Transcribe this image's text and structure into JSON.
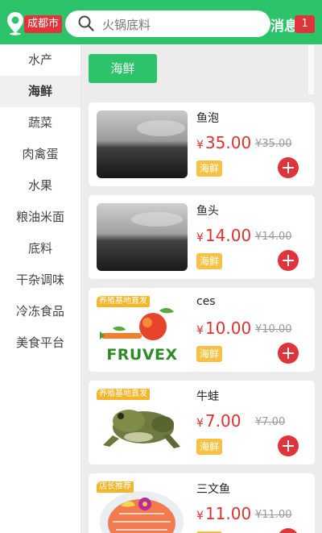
{
  "header": {
    "city": "成都市",
    "search_placeholder": "火锅底料",
    "messages_label": "消息",
    "messages_count": "1",
    "accent_color": "#2cc36b"
  },
  "sidebar": {
    "items": [
      {
        "label": "水产"
      },
      {
        "label": "海鲜",
        "active": true
      },
      {
        "label": "蔬菜"
      },
      {
        "label": "肉禽蛋"
      },
      {
        "label": "水果"
      },
      {
        "label": "粮油米面"
      },
      {
        "label": "底料"
      },
      {
        "label": "干杂调味"
      },
      {
        "label": "冷冻食品"
      },
      {
        "label": "美食平台"
      }
    ]
  },
  "subcategory": {
    "selected": "海鲜"
  },
  "products": [
    {
      "name": "鱼泡",
      "currency": "¥",
      "price": "35.00",
      "original_price": "¥35.00",
      "tag": "海鲜",
      "image_icon": "fish-photo"
    },
    {
      "name": "鱼头",
      "currency": "¥",
      "price": "14.00",
      "original_price": "¥14.00",
      "tag": "海鲜",
      "image_icon": "fish-photo"
    },
    {
      "name": "ces",
      "currency": "¥",
      "price": "10.00",
      "original_price": "¥10.00",
      "tag": "海鲜",
      "image_label": "养殖基地直发",
      "image_text": "FRUVEX",
      "image_icon": "fruit-logo"
    },
    {
      "name": "牛蛙",
      "currency": "¥",
      "price": "7.00",
      "original_price": "¥7.00",
      "tag": "海鲜",
      "image_label": "养殖基地直发",
      "image_icon": "bullfrog-photo"
    },
    {
      "name": "三文鱼",
      "currency": "¥",
      "price": "11.00",
      "original_price": "¥11.00",
      "tag": "海鲜",
      "image_label": "店长推荐",
      "image_icon": "salmon-photo"
    }
  ]
}
